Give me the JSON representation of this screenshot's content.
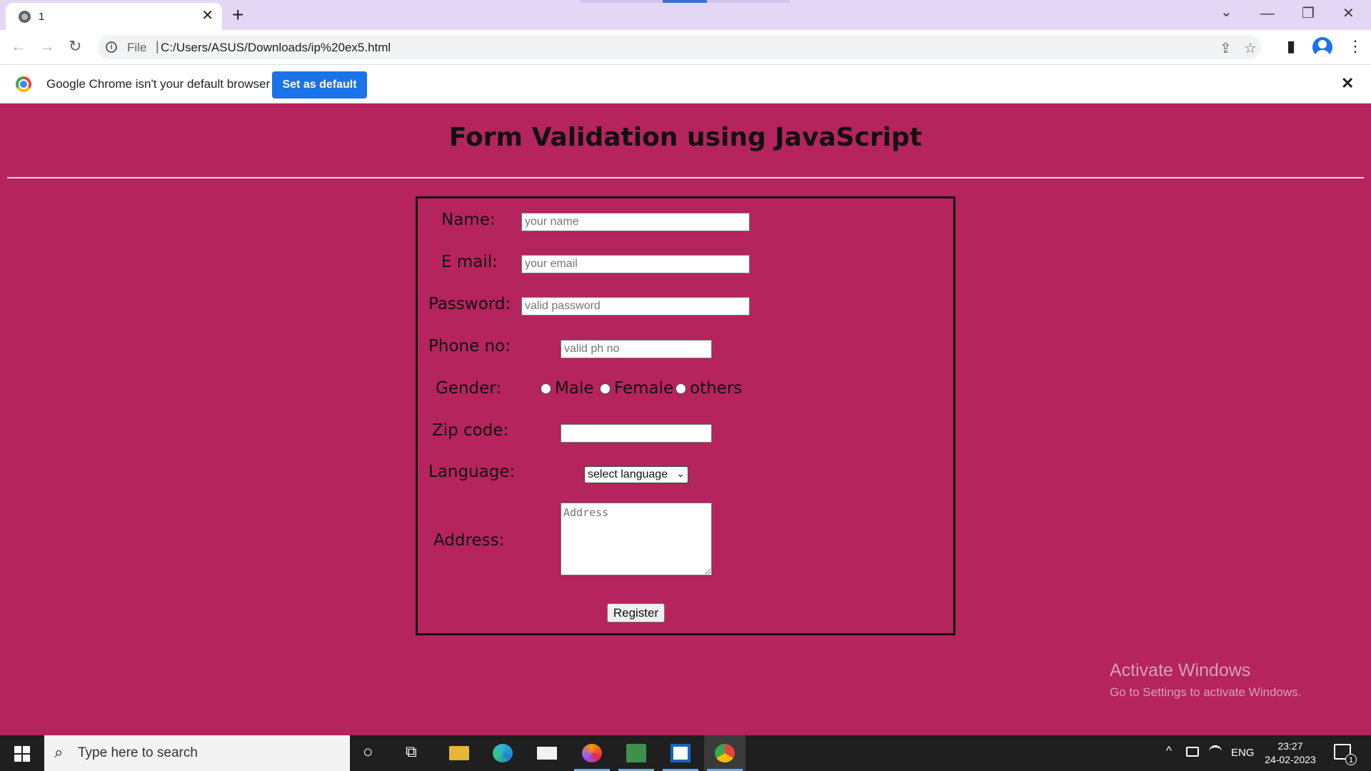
{
  "browser": {
    "tab_title": "1",
    "address_scheme": "File",
    "address_url": "C:/Users/ASUS/Downloads/ip%20ex5.html",
    "infobar_text": "Google Chrome isn't your default browser",
    "infobar_button": "Set as default",
    "icons": {
      "tab_close": "✕",
      "new_tab": "+",
      "tab_search": "⌄",
      "minimize": "—",
      "restore": "❐",
      "window_close": "✕",
      "back": "←",
      "forward": "→",
      "reload": "↻",
      "info": "i",
      "share": "⇪",
      "bookmark": "☆",
      "side_panel": "▮",
      "menu": "⋮",
      "infobar_close": "✕"
    }
  },
  "page": {
    "title": "Form Validation using JavaScript",
    "background_color": "#b5245c",
    "form": {
      "name_label": "Name:",
      "name_placeholder": "your name",
      "email_label": "E mail:",
      "email_placeholder": "your email",
      "password_label": "Password:",
      "password_placeholder": "valid password",
      "phone_label": "Phone no:",
      "phone_placeholder": "valid ph no",
      "gender_label": "Gender:",
      "gender_options": [
        "Male",
        "Female",
        "others"
      ],
      "zip_label": "Zip code:",
      "zip_value": "",
      "language_label": "Language:",
      "language_selected": "select language",
      "language_arrow": "⌄",
      "address_label": "Address:",
      "address_placeholder": "Address",
      "register_button": "Register"
    }
  },
  "watermark": {
    "title": "Activate Windows",
    "subtitle": "Go to Settings to activate Windows."
  },
  "taskbar": {
    "search_placeholder": "Type here to search",
    "search_icon": "⌕",
    "cortana_icon": "○",
    "task_view_icon": "⧉",
    "tray_chevron": "^",
    "language": "ENG",
    "time": "23:27",
    "date": "24-02-2023",
    "notification_count": "1"
  }
}
